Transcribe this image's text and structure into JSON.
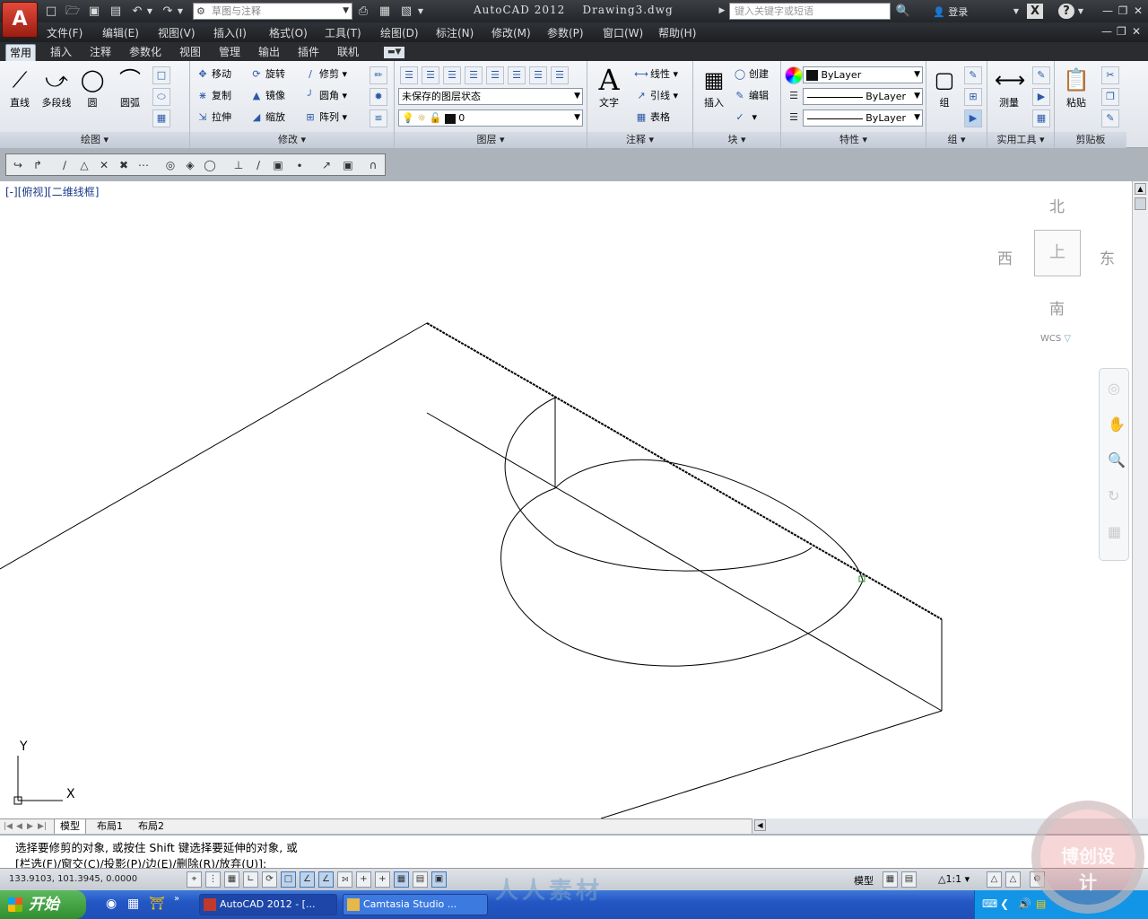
{
  "app": {
    "logo_letter": "A",
    "title": "AutoCAD 2012",
    "document": "Drawing3.dwg",
    "workspace": "草图与注释",
    "search_placeholder": "键入关键字或短语",
    "login": "登录"
  },
  "menu": [
    "文件(F)",
    "编辑(E)",
    "视图(V)",
    "插入(I)",
    "格式(O)",
    "工具(T)",
    "绘图(D)",
    "标注(N)",
    "修改(M)",
    "参数(P)",
    "窗口(W)",
    "帮助(H)"
  ],
  "tabs": [
    "常用",
    "插入",
    "注释",
    "参数化",
    "视图",
    "管理",
    "输出",
    "插件",
    "联机"
  ],
  "ribbon": {
    "draw": {
      "title": "绘图",
      "line": "直线",
      "polyline": "多段线",
      "circle": "圆",
      "arc": "圆弧"
    },
    "modify": {
      "title": "修改",
      "move": "移动",
      "rotate": "旋转",
      "trim": "修剪",
      "copy": "复制",
      "mirror": "镜像",
      "fillet": "圆角",
      "stretch": "拉伸",
      "scale": "缩放",
      "array": "阵列"
    },
    "layers": {
      "title": "图层",
      "state": "未保存的图层状态",
      "current": "0"
    },
    "annotation": {
      "title": "注释",
      "text": "文字",
      "linear": "线性",
      "leader": "引线",
      "table": "表格"
    },
    "block": {
      "title": "块",
      "insert": "插入",
      "create": "创建",
      "edit": "编辑"
    },
    "properties": {
      "title": "特性",
      "color": "ByLayer",
      "linetype": "ByLayer",
      "lineweight": "ByLayer"
    },
    "groups": {
      "title": "组",
      "group": "组"
    },
    "utilities": {
      "title": "实用工具",
      "measure": "测量"
    },
    "clipboard": {
      "title": "剪贴板",
      "paste": "粘贴"
    }
  },
  "viewport": {
    "label": "[-][俯视][二维线框]",
    "viewcube": {
      "north": "北",
      "south": "南",
      "east": "东",
      "west": "西",
      "top": "上",
      "wcs": "WCS"
    },
    "ucs": {
      "x": "X",
      "y": "Y"
    }
  },
  "layouts": [
    "模型",
    "布局1",
    "布局2"
  ],
  "command": {
    "line1": "选择要修剪的对象, 或按住 Shift 键选择要延伸的对象, 或",
    "line2": "[栏选(F)/窗交(C)/投影(P)/边(E)/删除(R)/放弃(U)]:"
  },
  "status": {
    "coords": "133.9103, 101.3945, 0.0000",
    "model": "模型",
    "scale": "1:1"
  },
  "taskbar": {
    "start": "开始",
    "tasks": [
      "AutoCAD 2012 - [...",
      "Camtasia Studio ..."
    ]
  },
  "watermark": {
    "text": "人人素材",
    "badge": "博创设计"
  }
}
